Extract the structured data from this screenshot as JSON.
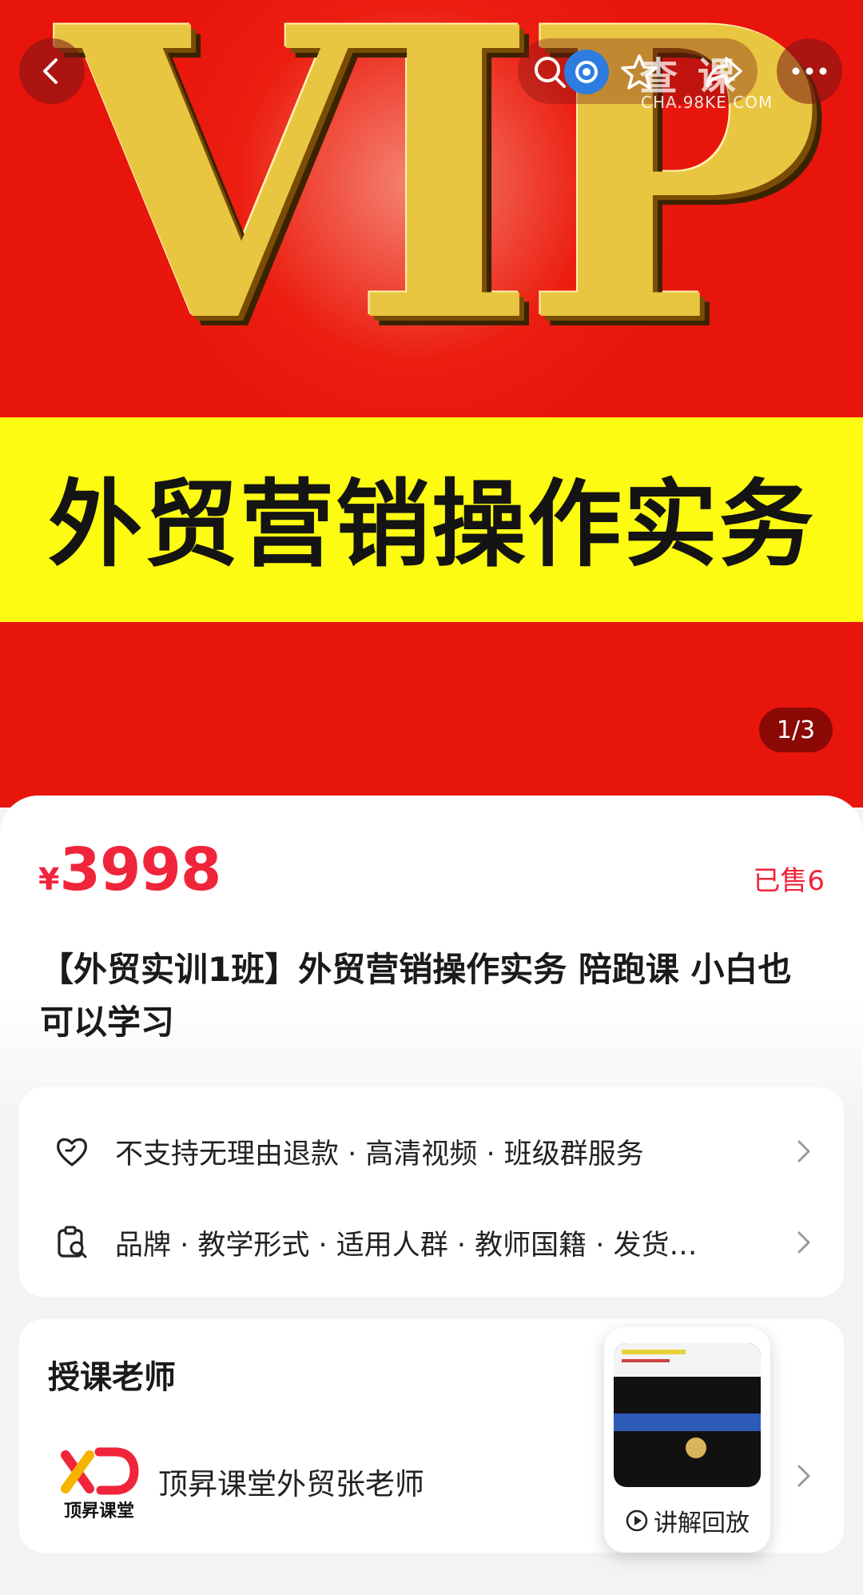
{
  "hero": {
    "vip_text": "VIP",
    "banner_title": "外贸营销操作实务",
    "watermark": "查 课",
    "watermark_url": "CHA.98KE.COM",
    "page_indicator": "1/3"
  },
  "product": {
    "price_symbol": "¥",
    "price": "3998",
    "sold": "已售6",
    "title": "【外贸实训1班】外贸营销操作实务 陪跑课 小白也可以学习"
  },
  "services": [
    {
      "icon": "heart-shield-icon",
      "text": "不支持无理由退款 · 高清视频 · 班级群服务"
    },
    {
      "icon": "clipboard-search-icon",
      "text": "品牌 · 教学形式 · 适用人群 · 教师国籍 · 发货…"
    }
  ],
  "teacher_section": {
    "title": "授课老师",
    "logo_text": "顶昇课堂",
    "name": "顶昇课堂外贸张老师"
  },
  "floating_video": {
    "label": "讲解回放"
  },
  "colors": {
    "accent": "#f0243a",
    "hero_red": "#e8150c",
    "banner_yellow": "#fdfb12"
  }
}
